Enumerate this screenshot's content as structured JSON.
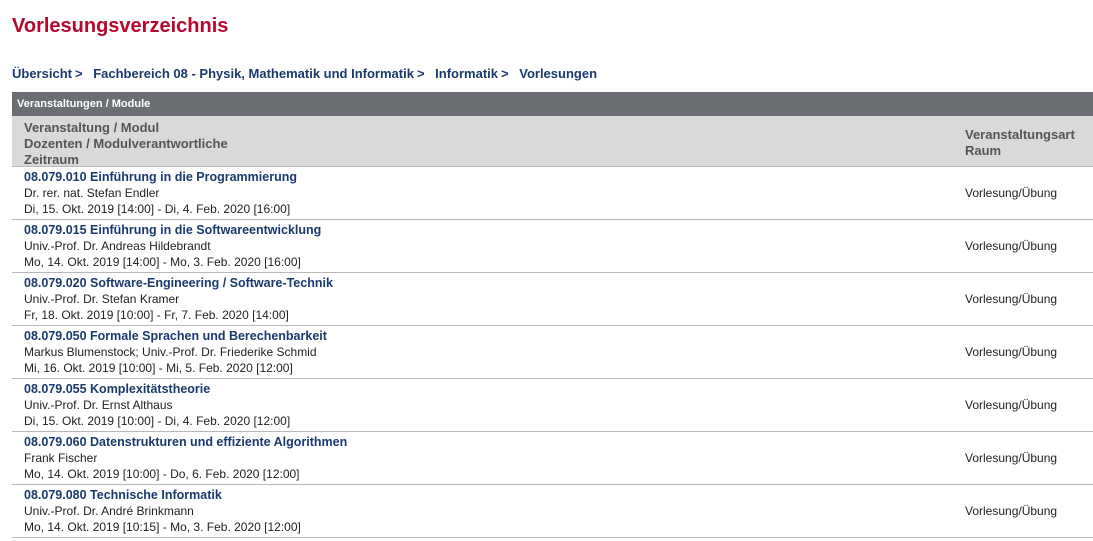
{
  "page": {
    "title": "Vorlesungsverzeichnis"
  },
  "breadcrumb": [
    {
      "label": "Übersicht",
      "sep": ">"
    },
    {
      "label": "Fachbereich 08 - Physik, Mathematik und Informatik",
      "sep": ">"
    },
    {
      "label": "Informatik",
      "sep": ">"
    },
    {
      "label": "Vorlesungen",
      "sep": ""
    }
  ],
  "table": {
    "section_label": "Veranstaltungen / Module",
    "headers": {
      "left": [
        "Veranstaltung / Modul",
        "Dozenten / Modulverantwortliche",
        "Zeitraum"
      ],
      "right": [
        "Veranstaltungsart",
        "Raum"
      ]
    },
    "rows": [
      {
        "title": "08.079.010 Einführung in die Programmierung",
        "lecturer": "Dr. rer. nat. Stefan Endler",
        "period": "Di, 15. Okt. 2019 [14:00] - Di, 4. Feb. 2020 [16:00]",
        "type": "Vorlesung/Übung"
      },
      {
        "title": "08.079.015 Einführung in die Softwareentwicklung",
        "lecturer": "Univ.-Prof. Dr. Andreas Hildebrandt",
        "period": "Mo, 14. Okt. 2019 [14:00] - Mo, 3. Feb. 2020 [16:00]",
        "type": "Vorlesung/Übung"
      },
      {
        "title": "08.079.020 Software-Engineering / Software-Technik",
        "lecturer": "Univ.-Prof. Dr. Stefan Kramer",
        "period": "Fr, 18. Okt. 2019 [10:00] - Fr, 7. Feb. 2020 [14:00]",
        "type": "Vorlesung/Übung"
      },
      {
        "title": "08.079.050 Formale Sprachen und Berechenbarkeit",
        "lecturer": "Markus Blumenstock; Univ.-Prof. Dr. Friederike Schmid",
        "period": "Mi, 16. Okt. 2019 [10:00] - Mi, 5. Feb. 2020 [12:00]",
        "type": "Vorlesung/Übung"
      },
      {
        "title": "08.079.055 Komplexitätstheorie",
        "lecturer": "Univ.-Prof. Dr. Ernst Althaus",
        "period": "Di, 15. Okt. 2019 [10:00] - Di, 4. Feb. 2020 [12:00]",
        "type": "Vorlesung/Übung"
      },
      {
        "title": "08.079.060 Datenstrukturen und effiziente Algorithmen",
        "lecturer": "Frank Fischer",
        "period": "Mo, 14. Okt. 2019 [10:00] - Do, 6. Feb. 2020 [12:00]",
        "type": "Vorlesung/Übung"
      },
      {
        "title": "08.079.080 Technische Informatik",
        "lecturer": "Univ.-Prof. Dr. André Brinkmann",
        "period": "Mo, 14. Okt. 2019 [10:15] - Mo, 3. Feb. 2020 [12:00]",
        "type": "Vorlesung/Übung"
      }
    ]
  },
  "colors": {
    "title_red": "#b5082c",
    "link_blue": "#1a3a6e",
    "section_gray": "#6b6f73",
    "header_gray": "#d9d9d9"
  }
}
